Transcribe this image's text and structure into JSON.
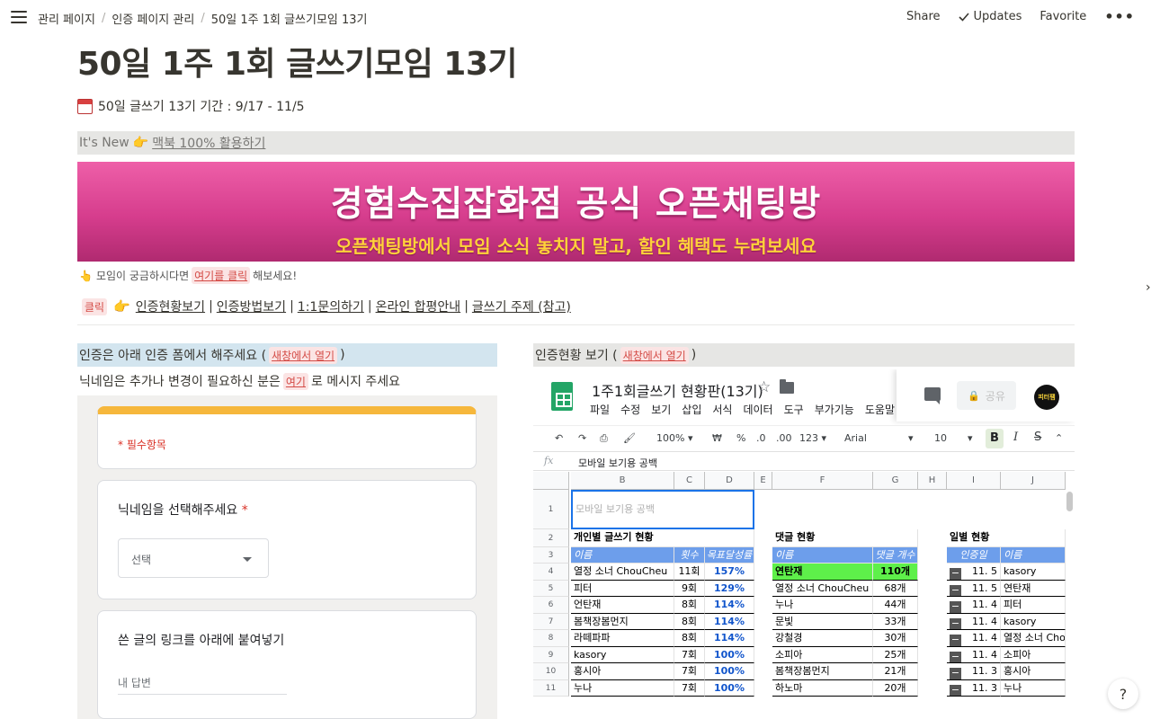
{
  "breadcrumb": [
    "관리 페이지",
    "인증 페이지 관리",
    "50일 1주 1회 글쓰기모임 13기"
  ],
  "top_actions": {
    "share": "Share",
    "updates": "Updates",
    "favorite": "Favorite",
    "more": "•••"
  },
  "page": {
    "title": "50일 1주 1회 글쓰기모임 13기",
    "period": "50일 글쓰기 13기 기간 : 9/17 - 11/5",
    "new_label": "It's New",
    "new_link": "맥북 100% 활용하기"
  },
  "banner": {
    "title": "경험수집잡화점 공식 오픈채팅방",
    "subtitle": "오픈채팅방에서 모임 소식 놓치지 말고, 할인 혜택도 누려보세요",
    "colors": {
      "top": "#ee5fa8",
      "bottom": "#b02a70",
      "subtitle": "#ffd23a"
    }
  },
  "curious": {
    "prefix": "모임이 궁금하시다면",
    "tag": "여기를 클릭",
    "suffix": "해보세요!"
  },
  "links_row": {
    "tag": "클릭",
    "links": [
      "인증현황보기",
      "인증방법보기",
      "1:1문의하기",
      "온라인 합평안내",
      "글쓰기 주제 (참고)"
    ]
  },
  "left": {
    "cert_text": "인증은 아래 인증 폼에서 해주세요 (",
    "cert_tag": "새창에서 열기",
    "cert_close": ")",
    "nick_prefix": "닉네임은 추가나 변경이 필요하신 분은",
    "nick_tag": "여기",
    "nick_suffix": "로 메시지 주세요",
    "form": {
      "required": "* 필수항목",
      "q1": "닉네임을 선택해주세요",
      "q1_star": "*",
      "select_value": "선택",
      "q2": "쓴 글의 링크를 아래에 붙여넣기",
      "answer_placeholder": "내 답변"
    }
  },
  "right": {
    "status_text": "인증현황 보기 (",
    "status_tag": "새창에서 열기",
    "status_close": ")",
    "sheet": {
      "title": "1주1회글쓰기 현황판(13기)",
      "menu": [
        "파일",
        "수정",
        "보기",
        "삽입",
        "서식",
        "데이터",
        "도구",
        "부가기능",
        "도움말"
      ],
      "share": "공유",
      "avatar_text": "피터팸",
      "toolbar": {
        "zoom": "100%",
        "currency": "₩",
        "percent": "%",
        "dec1": ".0",
        "dec2": ".00",
        "fmt": "123",
        "font": "Arial",
        "size": "10",
        "bold": "B",
        "italic": "I",
        "strike": "S"
      },
      "fx": "fx",
      "formula": "모바일 보기용 공백",
      "columns": [
        "B",
        "C",
        "D",
        "E",
        "F",
        "G",
        "H",
        "I",
        "J"
      ],
      "row_numbers": [
        "1",
        "2",
        "3",
        "4",
        "5",
        "6",
        "7",
        "8",
        "9",
        "10",
        "11"
      ],
      "mobile_blank": "모바일 보기용 공백",
      "sec_personal": "개인별 글쓰기 현황",
      "sec_comments": "댓글 현황",
      "sec_daily": "일별 현황",
      "hdr_name": "이름",
      "hdr_count": "횟수",
      "hdr_rate": "목표달성률",
      "hdr_cname": "이름",
      "hdr_ccount": "댓글 개수",
      "hdr_date": "인증일",
      "hdr_dname": "이름",
      "personal": [
        {
          "name": "열정 소너 ChouCheu",
          "count": "11회",
          "rate": "157%"
        },
        {
          "name": "피터",
          "count": "9회",
          "rate": "129%"
        },
        {
          "name": "언탄재",
          "count": "8회",
          "rate": "114%"
        },
        {
          "name": "봄책장봄먼지",
          "count": "8회",
          "rate": "114%"
        },
        {
          "name": "라떼파파",
          "count": "8회",
          "rate": "114%"
        },
        {
          "name": "kasory",
          "count": "7회",
          "rate": "100%"
        },
        {
          "name": "홍시아",
          "count": "7회",
          "rate": "100%"
        },
        {
          "name": "누나",
          "count": "7회",
          "rate": "100%"
        }
      ],
      "comments": [
        {
          "name": "연탄재",
          "count": "110개"
        },
        {
          "name": "열정 소너 ChouCheu",
          "count": "68개"
        },
        {
          "name": "누나",
          "count": "44개"
        },
        {
          "name": "문빛",
          "count": "33개"
        },
        {
          "name": "강철경",
          "count": "30개"
        },
        {
          "name": "소피아",
          "count": "25개"
        },
        {
          "name": "봄책장봄먼지",
          "count": "21개"
        },
        {
          "name": "하노마",
          "count": "20개"
        }
      ],
      "daily": [
        {
          "date": "11. 5",
          "name": "kasory"
        },
        {
          "date": "11. 5",
          "name": "연탄재"
        },
        {
          "date": "11. 4",
          "name": "피터"
        },
        {
          "date": "11. 4",
          "name": "kasory"
        },
        {
          "date": "11. 4",
          "name": "열정 소너 Cho"
        },
        {
          "date": "11. 4",
          "name": "소피아"
        },
        {
          "date": "11. 3",
          "name": "홍시아"
        },
        {
          "date": "11. 3",
          "name": "누나"
        }
      ]
    }
  },
  "help": "?",
  "edge": "›"
}
